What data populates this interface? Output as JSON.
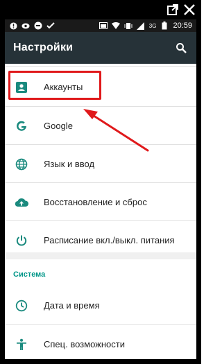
{
  "window_controls": {
    "external_link_icon": "external-link-icon",
    "close_icon": "close-icon"
  },
  "status_bar": {
    "network": "3G",
    "time": "20:59"
  },
  "appbar": {
    "title": "Настройки",
    "search_icon": "search-icon"
  },
  "items": [
    {
      "label": "Аккаунты",
      "icon": "account-box-icon"
    },
    {
      "label": "Google",
      "icon": "google-g-icon"
    },
    {
      "label": "Язык и ввод",
      "icon": "globe-icon"
    },
    {
      "label": "Восстановление и сброс",
      "icon": "cloud-upload-icon"
    },
    {
      "label": "Расписание вкл./выкл. питания",
      "icon": "power-icon"
    }
  ],
  "section": {
    "title": "Система"
  },
  "system_items": [
    {
      "label": "Дата и время",
      "icon": "clock-icon"
    },
    {
      "label": "Спец. возможности",
      "icon": "accessibility-icon"
    }
  ],
  "colors": {
    "appbar": "#263238",
    "accent": "#009688",
    "icon": "#1a8a7e",
    "highlight": "#e0191b"
  }
}
